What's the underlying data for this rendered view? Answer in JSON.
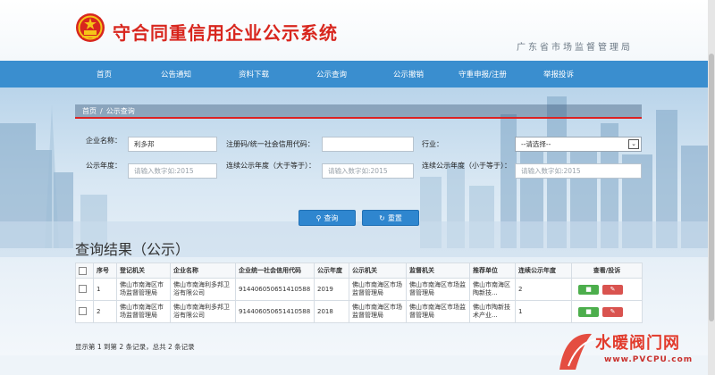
{
  "header": {
    "site_title": "守合同重信用企业公示系统",
    "org_name": "广东省市场监督管理局"
  },
  "nav": [
    "首页",
    "公告通知",
    "资料下载",
    "公示查询",
    "公示撤销",
    "守重申报/注册",
    "举报投诉"
  ],
  "breadcrumb": {
    "home": "首页",
    "sep": "/",
    "current": "公示查询"
  },
  "form": {
    "company_name_label": "企业名称：",
    "company_name_value": "利多邦",
    "credit_code_label": "注册码/统一社会信用代码：",
    "credit_code_value": "",
    "industry_label": "行业：",
    "industry_selected": "--请选择--",
    "year_label": "公示年度：",
    "year_placeholder": "请输入数字如:2015",
    "cont_gt_label": "连续公示年度（大于等于）：",
    "cont_gt_placeholder": "请输入数字如:2015",
    "cont_lt_label": "连续公示年度（小于等于）：",
    "cont_lt_placeholder": "请输入数字如:2015",
    "query_button": "查询",
    "reset_button": "重置"
  },
  "results": {
    "title": "查询结果（公示）",
    "columns": [
      "",
      "序号",
      "登记机关",
      "企业名称",
      "企业统一社会信用代码",
      "公示年度",
      "公示机关",
      "监督机关",
      "推荐单位",
      "连续公示年度",
      "查看/投诉"
    ],
    "rows": [
      {
        "no": "1",
        "reg_office": "佛山市南海区市场监督管理局",
        "company": "佛山市南海利多邦卫浴有限公司",
        "code": "91440605065141058​8",
        "year": "2019",
        "pub_office": "佛山市南海区市场监督管理局",
        "sup_office": "佛山市南海区市场监督管理局",
        "recommender": "佛山市南海区陶新技...",
        "cont_years": "2"
      },
      {
        "no": "2",
        "reg_office": "佛山市南海区市场监督管理局",
        "company": "佛山市南海利多邦卫浴有限公司",
        "code": "914406050651410588",
        "year": "2018",
        "pub_office": "佛山市南海区市场监督管理局",
        "sup_office": "佛山市南海区市场监督管理局",
        "recommender": "佛山市陶新技术产业...",
        "cont_years": "1"
      }
    ],
    "pager": "显示第 1 到第 2 条记录，总共 2 条记录"
  },
  "watermark": {
    "text": "水暖阀门网",
    "url": "www.PVCPU.com"
  },
  "colors": {
    "nav_blue": "#3a8ecf",
    "title_red": "#d8261e",
    "view_green": "#4cae4c",
    "edit_red": "#d9534f"
  }
}
